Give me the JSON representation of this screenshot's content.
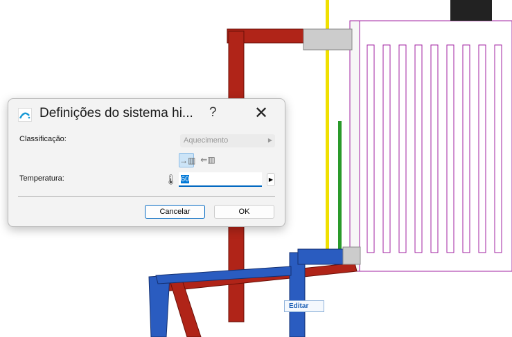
{
  "dialog": {
    "title": "Definições do sistema hi...",
    "help": "?",
    "close": "✕",
    "classification_label": "Classificação:",
    "classification_value": "Aquecimento",
    "temperature_label": "Temperatura:",
    "temperature_value": "60",
    "cancel": "Cancelar",
    "ok": "OK"
  },
  "tooltip": "Editar"
}
